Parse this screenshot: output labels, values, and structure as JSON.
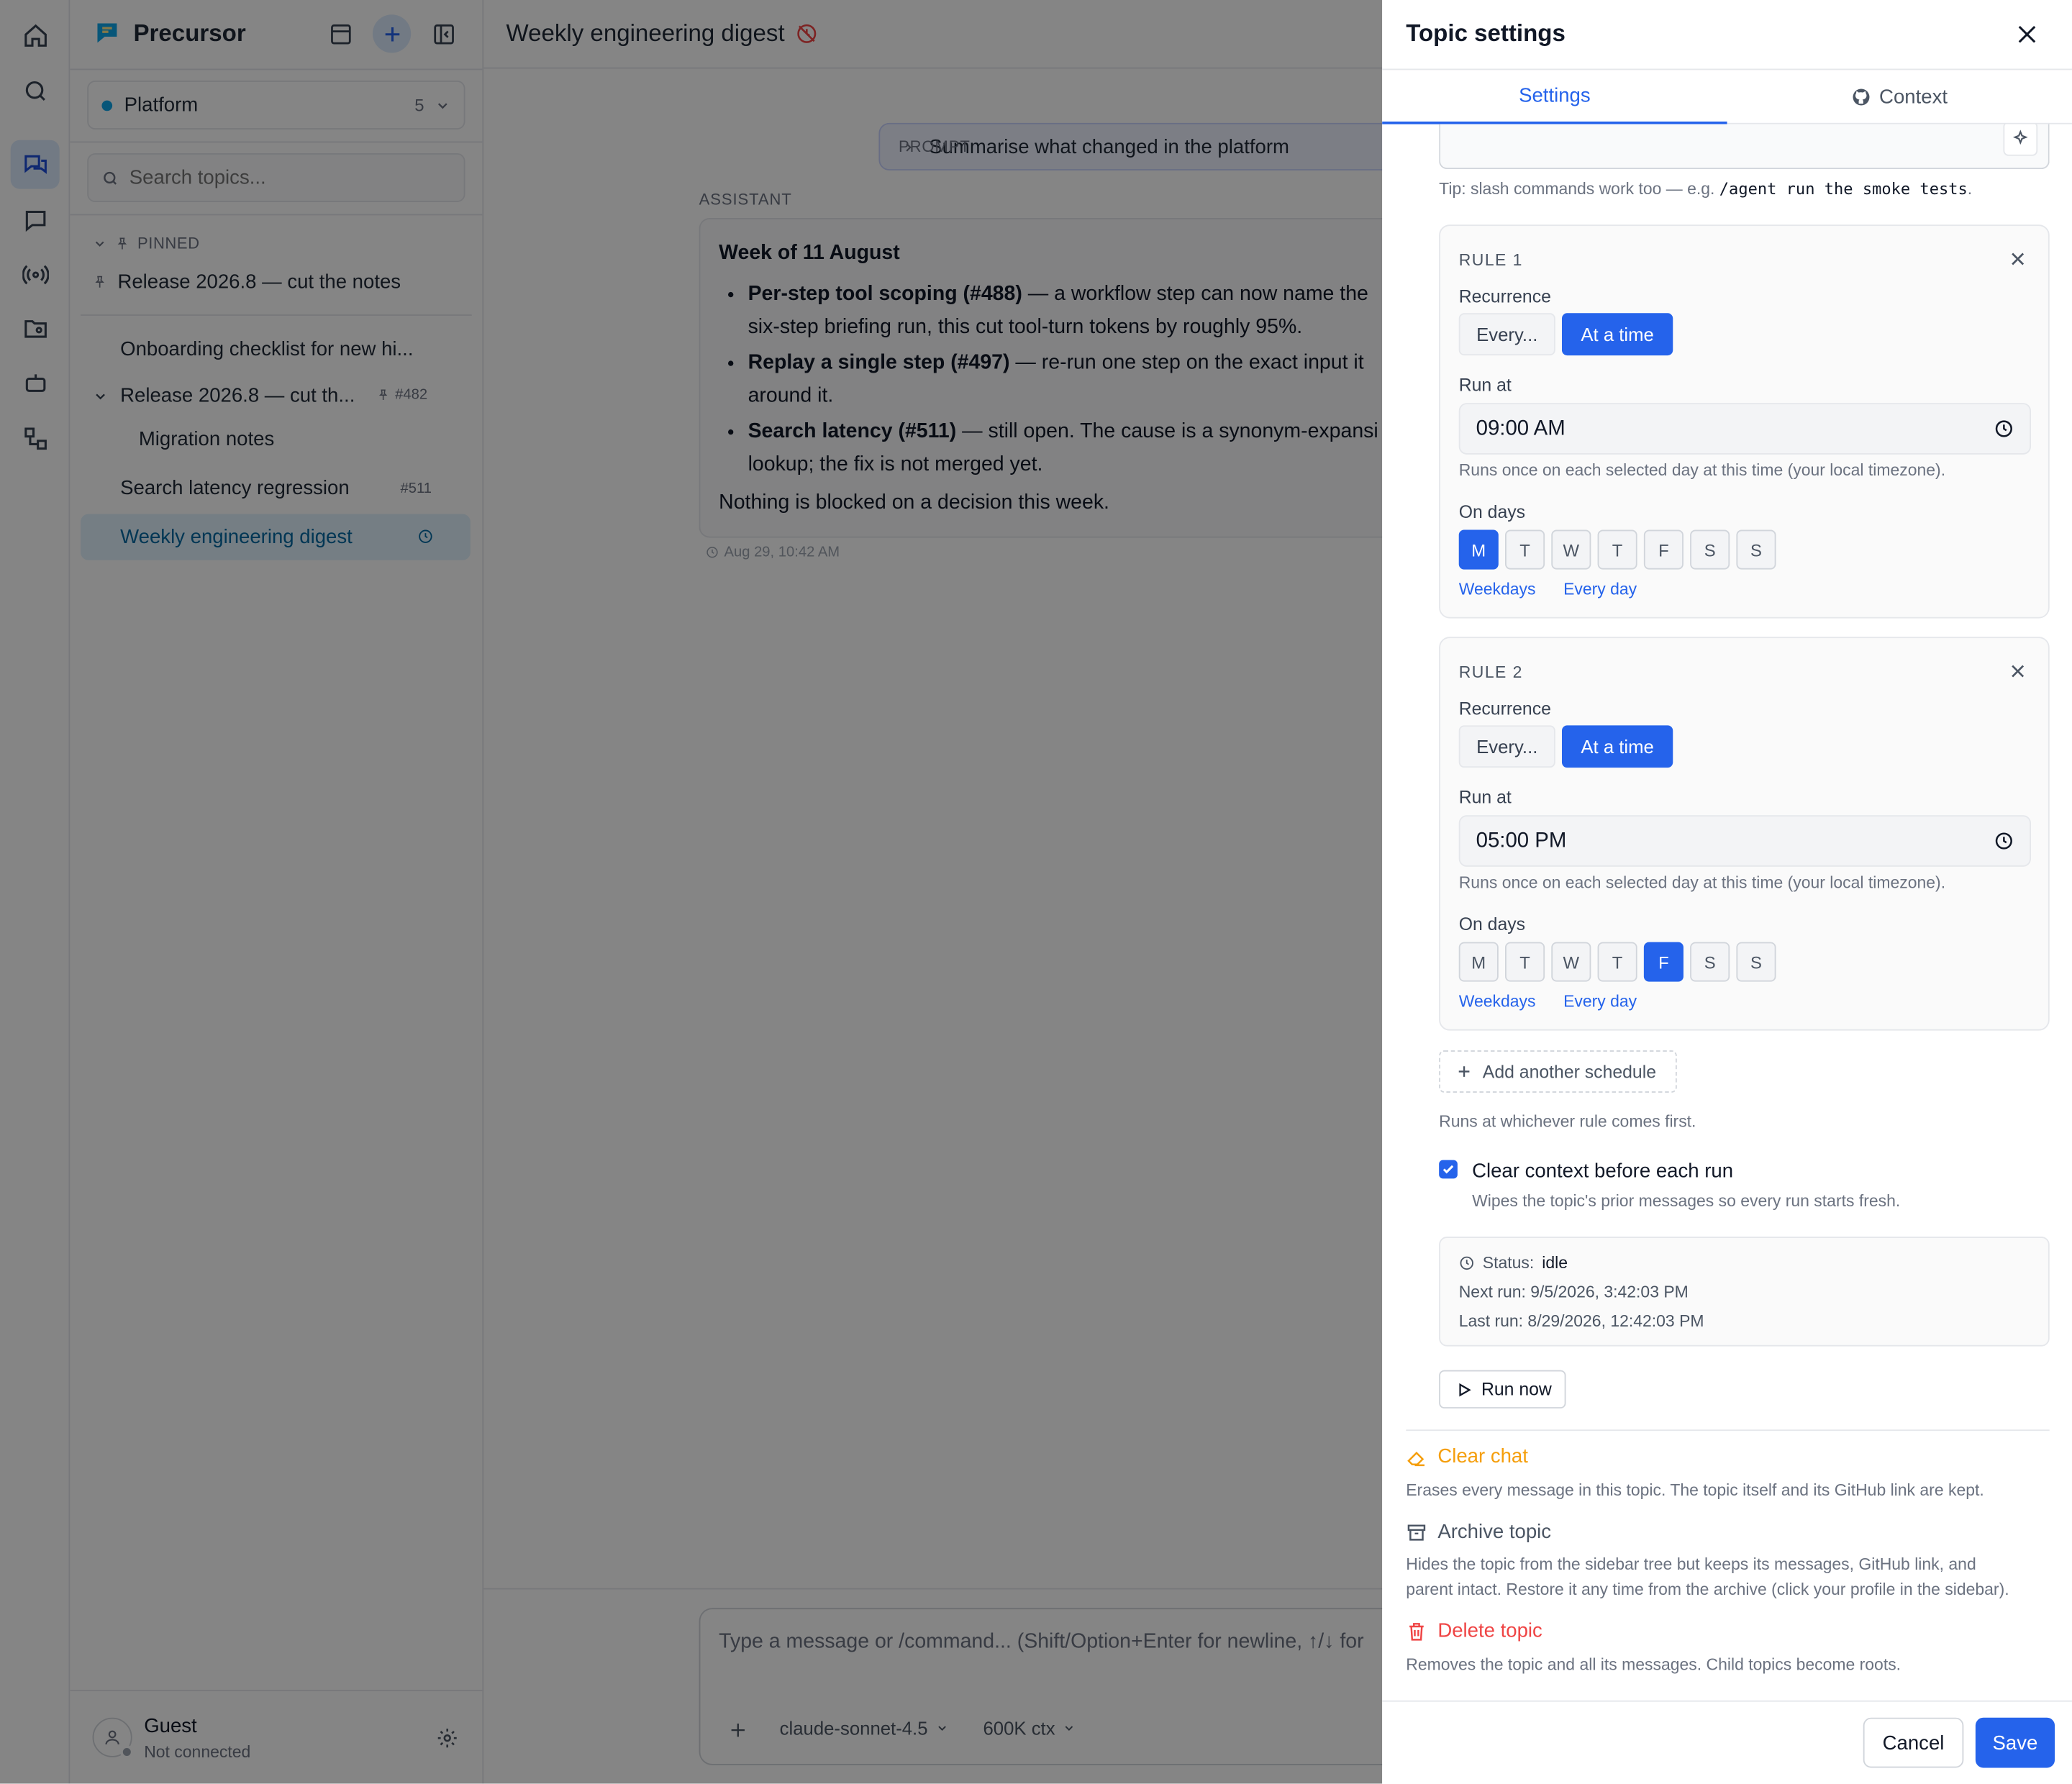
{
  "app": {
    "name": "Precursor"
  },
  "rail": {
    "icons": [
      "home-icon",
      "search-icon",
      "topics-icon",
      "chat-icon",
      "broadcast-icon",
      "folder-user-icon",
      "bot-icon",
      "flow-icon"
    ]
  },
  "sidebar": {
    "workspace": {
      "name": "Platform",
      "count": "5"
    },
    "search_placeholder": "Search topics...",
    "pinned_label": "PINNED",
    "pinned_items": [
      {
        "label": "Release 2026.8 — cut the notes"
      }
    ],
    "items": [
      {
        "label": "Onboarding checklist for new hi..."
      },
      {
        "label": "Release 2026.8 — cut th...",
        "badge": "#482"
      },
      {
        "label": "Migration notes"
      },
      {
        "label": "Search latency regression",
        "badge": "#511"
      },
      {
        "label": "Weekly engineering digest"
      }
    ],
    "user": {
      "name": "Guest",
      "status": "Not connected"
    }
  },
  "main": {
    "title": "Weekly engineering digest",
    "prompt": {
      "label": "PROMPT",
      "text": "Summarise what changed in the platform"
    },
    "role": "ASSISTANT",
    "message": {
      "heading": "Week of 11 August",
      "bullets": [
        {
          "bold": "Per-step tool scoping (#488)",
          "text": " — a workflow step can now name the",
          "cont": "six-step briefing run, this cut tool-turn tokens by roughly 95%."
        },
        {
          "bold": "Replay a single step (#497)",
          "text": " — re-run one step on the exact input it",
          "cont": "around it."
        },
        {
          "bold": "Search latency (#511)",
          "text": " — still open. The cause is a synonym-expansi",
          "cont": "lookup; the fix is not merged yet."
        }
      ],
      "footer": "Nothing is blocked on a decision this week."
    },
    "timestamp": "Aug 29, 10:42 AM",
    "composer": {
      "placeholder": "Type a message or /command... (Shift/Option+Enter for newline, ↑/↓ for",
      "model": "claude-sonnet-4.5",
      "ctx": "600K ctx"
    }
  },
  "panel": {
    "title": "Topic settings",
    "tabs": [
      {
        "label": "Settings"
      },
      {
        "label": "Context"
      }
    ],
    "tip_prefix": "Tip: slash commands work too — e.g. ",
    "tip_code": "/agent run the smoke tests",
    "tip_suffix": ".",
    "rules": [
      {
        "title": "RULE 1",
        "recurrence_label": "Recurrence",
        "opt_every": "Every...",
        "opt_at": "At a time",
        "run_at_label": "Run at",
        "time": "09:00 AM",
        "hint": "Runs once on each selected day at this time (your local timezone).",
        "days_label": "On days",
        "days": [
          "M",
          "T",
          "W",
          "T",
          "F",
          "S",
          "S"
        ],
        "selected": [
          0
        ],
        "link_weekdays": "Weekdays",
        "link_everyday": "Every day"
      },
      {
        "title": "RULE 2",
        "recurrence_label": "Recurrence",
        "opt_every": "Every...",
        "opt_at": "At a time",
        "run_at_label": "Run at",
        "time": "05:00 PM",
        "hint": "Runs once on each selected day at this time (your local timezone).",
        "days_label": "On days",
        "days": [
          "M",
          "T",
          "W",
          "T",
          "F",
          "S",
          "S"
        ],
        "selected": [
          4
        ],
        "link_weekdays": "Weekdays",
        "link_everyday": "Every day"
      }
    ],
    "add_schedule": "Add another schedule",
    "whichever": "Runs at whichever rule comes first.",
    "clear_context": {
      "label": "Clear context before each run",
      "desc": "Wipes the topic's prior messages so every run starts fresh.",
      "checked": true
    },
    "status": {
      "label": "Status:",
      "value": "idle",
      "next": "Next run: 9/5/2026, 3:42:03 PM",
      "last": "Last run: 8/29/2026, 12:42:03 PM"
    },
    "run_now": "Run now",
    "danger": [
      {
        "title": "Clear chat",
        "desc": "Erases every message in this topic. The topic itself and its GitHub link are kept.",
        "color": "#f59e0b"
      },
      {
        "title": "Archive topic",
        "desc": "Hides the topic from the sidebar tree but keeps its messages, GitHub link, and parent intact. Restore it any time from the archive (click your profile in the sidebar).",
        "color": "#6b7280"
      },
      {
        "title": "Delete topic",
        "desc": "Removes the topic and all its messages. Child topics become roots.",
        "color": "#ef4444"
      }
    ],
    "cancel": "Cancel",
    "save": "Save"
  },
  "colors": {
    "accent": "#2563eb",
    "active_bg": "#e0f2fe"
  }
}
